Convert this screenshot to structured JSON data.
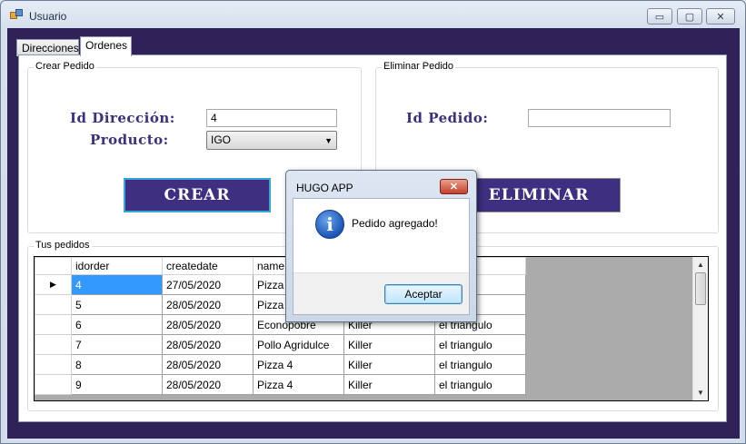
{
  "window": {
    "title": "Usuario",
    "controls": {
      "minimize": "▭",
      "maximize": "▢",
      "close": "✕"
    }
  },
  "tabs": [
    {
      "label": "Direcciones",
      "active": false
    },
    {
      "label": "Ordenes",
      "active": true
    }
  ],
  "crear_pedido": {
    "legend": "Crear Pedido",
    "id_direccion_label": "Id Dirección:",
    "id_direccion_value": "4",
    "producto_label": "Producto:",
    "producto_value": "IGO",
    "crear_button": "CREAR"
  },
  "eliminar_pedido": {
    "legend": "Eliminar Pedido",
    "id_pedido_label": "Id Pedido:",
    "id_pedido_value": "",
    "eliminar_button": "ELIMINAR"
  },
  "tus_pedidos": {
    "legend": "Tus pedidos",
    "columns": [
      "idorder",
      "createdate",
      "name",
      "",
      ""
    ],
    "rows": [
      [
        "4",
        "27/05/2020",
        "Pizza 4",
        "",
        "gulo"
      ],
      [
        "5",
        "28/05/2020",
        "Pizza 4",
        "",
        "gulo"
      ],
      [
        "6",
        "28/05/2020",
        "Econopobre",
        "Killer",
        "el triangulo"
      ],
      [
        "7",
        "28/05/2020",
        "Pollo Agridulce",
        "Killer",
        "el triangulo"
      ],
      [
        "8",
        "28/05/2020",
        "Pizza 4",
        "Killer",
        "el triangulo"
      ],
      [
        "9",
        "28/05/2020",
        "Pizza 4",
        "Killer",
        "el triangulo"
      ]
    ],
    "selected_row": 0
  },
  "dialog": {
    "title": "HUGO APP",
    "close": "✕",
    "message": "Pedido agregado!",
    "ok_button": "Aceptar",
    "icon": "info-icon"
  },
  "colors": {
    "accent_purple": "#3e2f80",
    "frame_purple": "#2e2258",
    "selection": "#3399ff"
  }
}
